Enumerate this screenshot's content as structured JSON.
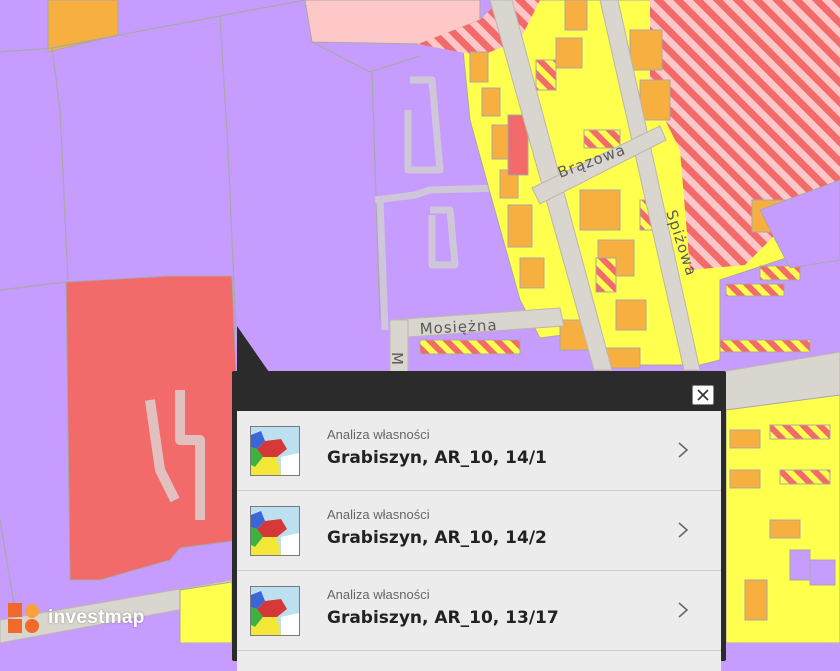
{
  "map": {
    "streets": [
      "Brązowa",
      "Spiżowa",
      "Mosiężna",
      "M"
    ],
    "zone_colors": {
      "services": "#c79cff",
      "industrial_red": "#f26a6a",
      "residential_yellow": "#ffff4d",
      "residential_orange": "#f7b040",
      "pink": "#ffc8c8",
      "hatch": "#f26a6a",
      "roads": "#d9d5cf",
      "parcel_lines": "#a8a8a8"
    }
  },
  "popup": {
    "close_icon": "close-icon",
    "results": [
      {
        "subtitle": "Analiza własności",
        "title": "Grabiszyn, AR_10, 14/1"
      },
      {
        "subtitle": "Analiza własności",
        "title": "Grabiszyn, AR_10, 14/2"
      },
      {
        "subtitle": "Analiza własności",
        "title": "Grabiszyn, AR_10, 13/17"
      }
    ]
  },
  "logo": {
    "text": "investmap",
    "icon": "investmap-logo-icon"
  }
}
